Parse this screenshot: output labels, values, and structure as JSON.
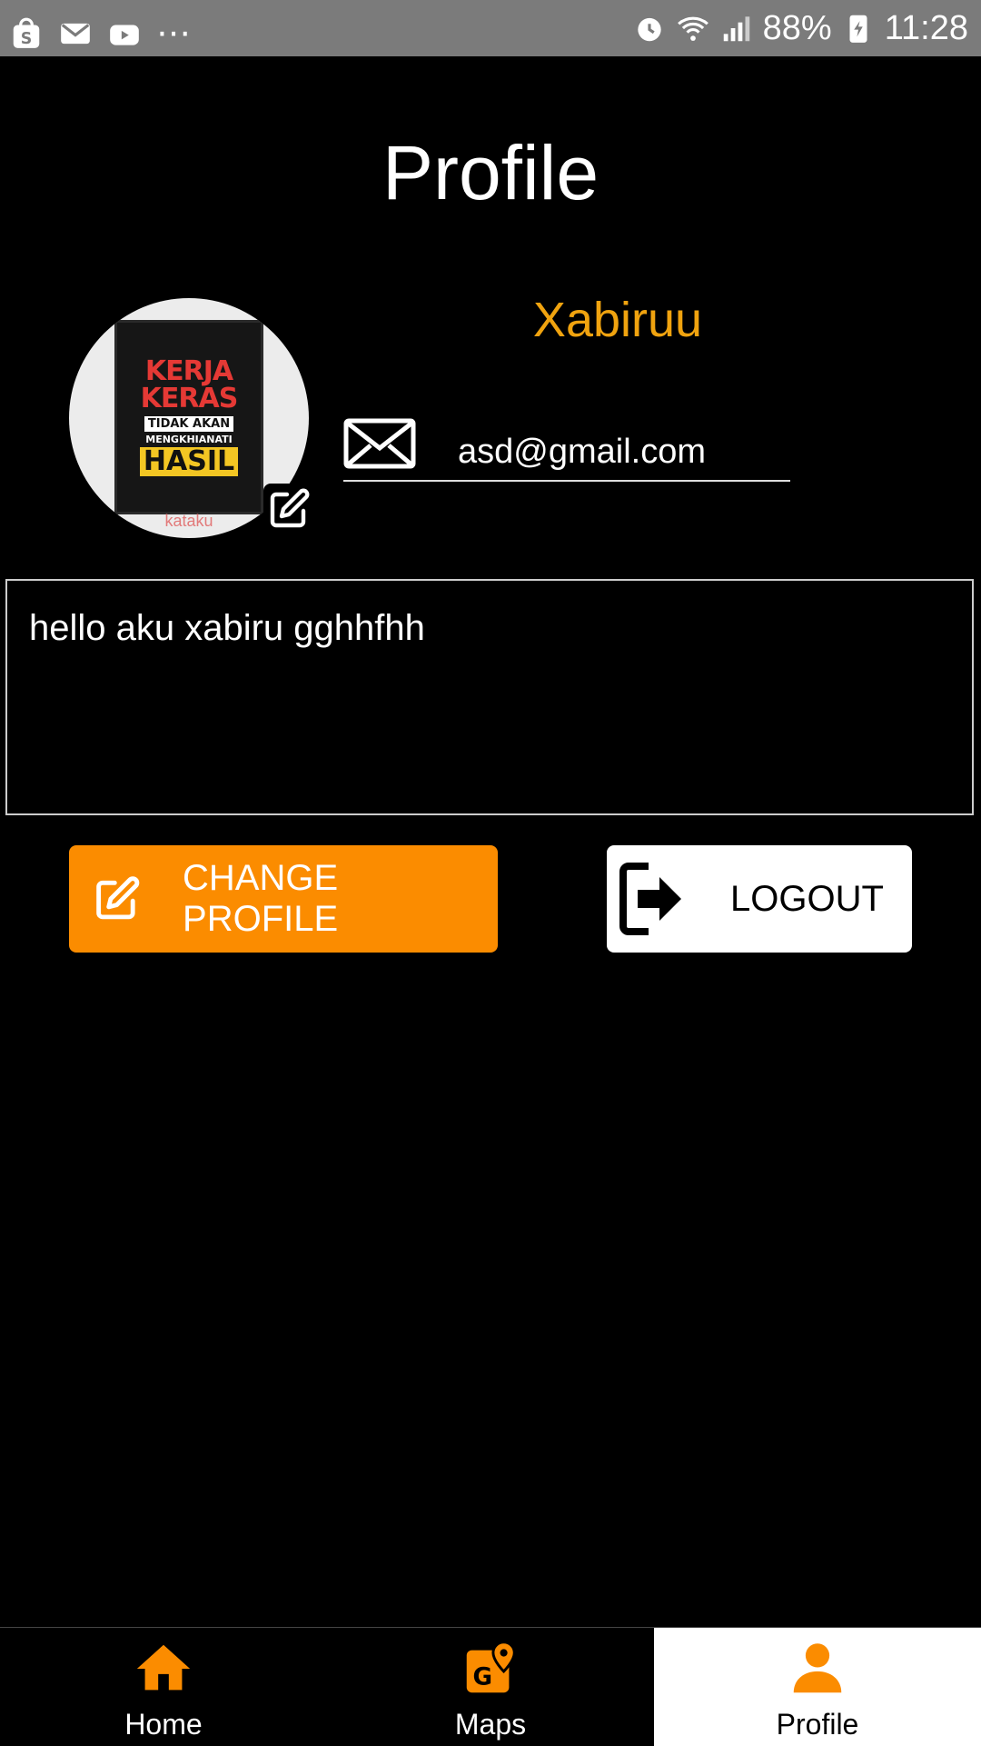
{
  "status_bar": {
    "battery": "88%",
    "time": "11:28",
    "left_icons": [
      "shopping-bag-icon",
      "mail-icon",
      "video-icon",
      "more-dots-icon"
    ],
    "right_icons": [
      "alarm-icon",
      "wifi-icon",
      "signal-icon",
      "battery-charging-icon"
    ]
  },
  "page": {
    "title": "Profile"
  },
  "profile": {
    "username": "Xabiruu",
    "email": "asd@gmail.com",
    "bio": "hello aku xabiru gghhfhh",
    "avatar": {
      "poster_line1": "KERJA",
      "poster_line2": "KERAS",
      "poster_line3": "TIDAK AKAN",
      "poster_line4": "MENGKHIANATI",
      "poster_line5": "HASIL",
      "watermark": "kataku"
    }
  },
  "buttons": {
    "change_profile": "CHANGE PROFILE",
    "logout": "LOGOUT"
  },
  "bottom_nav": {
    "items": [
      {
        "label": "Home",
        "icon": "home-icon"
      },
      {
        "label": "Maps",
        "icon": "map-pin-icon"
      },
      {
        "label": "Profile",
        "icon": "person-icon"
      }
    ],
    "active": "Profile"
  },
  "colors": {
    "accent": "#fb8c00",
    "username": "#f0a30f",
    "statusbar": "#7b7b7b",
    "background": "#000000"
  }
}
